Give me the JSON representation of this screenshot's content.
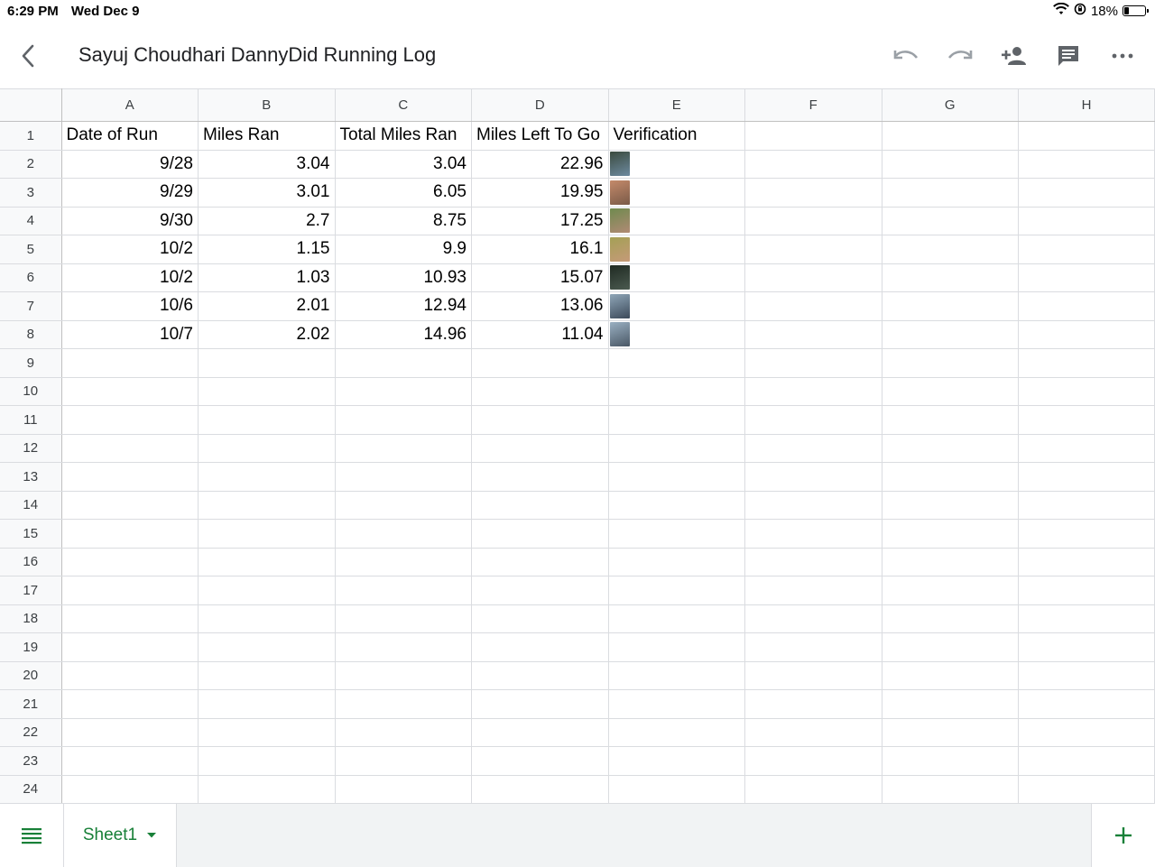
{
  "status": {
    "time": "6:29 PM",
    "date": "Wed Dec 9",
    "battery": "18%",
    "battery_level": 0.18
  },
  "doc": {
    "title": "Sayuj Choudhari DannyDid Running Log"
  },
  "columns": [
    "A",
    "B",
    "C",
    "D",
    "E",
    "F",
    "G",
    "H"
  ],
  "header_row": [
    "Date of Run",
    "Miles Ran",
    "Total Miles Ran",
    "Miles Left To Go",
    "Verification"
  ],
  "rows": [
    {
      "date": "9/28",
      "miles": "3.04",
      "total": "3.04",
      "left": "22.96"
    },
    {
      "date": "9/29",
      "miles": "3.01",
      "total": "6.05",
      "left": "19.95"
    },
    {
      "date": "9/30",
      "miles": "2.7",
      "total": "8.75",
      "left": "17.25"
    },
    {
      "date": "10/2",
      "miles": "1.15",
      "total": "9.9",
      "left": "16.1"
    },
    {
      "date": "10/2",
      "miles": "1.03",
      "total": "10.93",
      "left": "15.07"
    },
    {
      "date": "10/6",
      "miles": "2.01",
      "total": "12.94",
      "left": "13.06"
    },
    {
      "date": "10/7",
      "miles": "2.02",
      "total": "14.96",
      "left": "11.04"
    }
  ],
  "verification_thumbs": [
    {
      "icon": "photo-thumbnail",
      "colors": [
        "#3a4a3e",
        "#6d8aa0"
      ]
    },
    {
      "icon": "photo-thumbnail",
      "colors": [
        "#c48a6a",
        "#7a5a48"
      ]
    },
    {
      "icon": "photo-thumbnail",
      "colors": [
        "#6f8a4e",
        "#b08a74"
      ]
    },
    {
      "icon": "photo-thumbnail",
      "colors": [
        "#a4a055",
        "#c59a78"
      ]
    },
    {
      "icon": "photo-thumbnail",
      "colors": [
        "#1f2a22",
        "#4b5a50"
      ]
    },
    {
      "icon": "photo-thumbnail",
      "colors": [
        "#8fa6b8",
        "#3c4a5a"
      ]
    },
    {
      "icon": "photo-thumbnail",
      "colors": [
        "#9ab0c2",
        "#4a5866"
      ]
    }
  ],
  "row_numbers": [
    "1",
    "2",
    "3",
    "4",
    "5",
    "6",
    "7",
    "8",
    "9",
    "10",
    "11",
    "12",
    "13",
    "14",
    "15",
    "16",
    "17",
    "18",
    "19",
    "20",
    "21",
    "22",
    "23",
    "24"
  ],
  "sheet": {
    "name": "Sheet1"
  },
  "colors": {
    "accent": "#188038",
    "icon_gray": "#5f6368",
    "icon_disabled": "#9aa0a6"
  }
}
